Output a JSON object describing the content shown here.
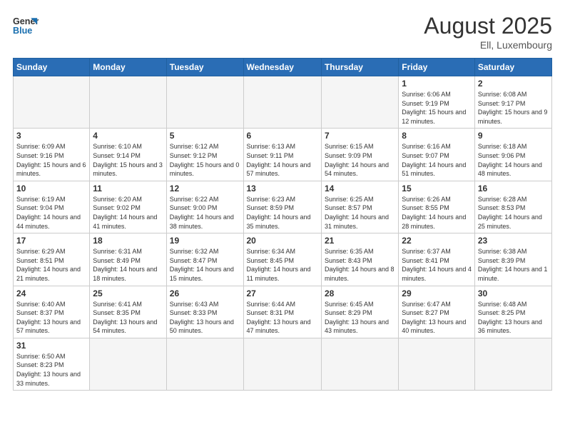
{
  "header": {
    "logo_general": "General",
    "logo_blue": "Blue",
    "title": "August 2025",
    "subtitle": "Ell, Luxembourg"
  },
  "days_of_week": [
    "Sunday",
    "Monday",
    "Tuesday",
    "Wednesday",
    "Thursday",
    "Friday",
    "Saturday"
  ],
  "weeks": [
    [
      {
        "day": "",
        "info": ""
      },
      {
        "day": "",
        "info": ""
      },
      {
        "day": "",
        "info": ""
      },
      {
        "day": "",
        "info": ""
      },
      {
        "day": "",
        "info": ""
      },
      {
        "day": "1",
        "info": "Sunrise: 6:06 AM\nSunset: 9:19 PM\nDaylight: 15 hours and 12 minutes."
      },
      {
        "day": "2",
        "info": "Sunrise: 6:08 AM\nSunset: 9:17 PM\nDaylight: 15 hours and 9 minutes."
      }
    ],
    [
      {
        "day": "3",
        "info": "Sunrise: 6:09 AM\nSunset: 9:16 PM\nDaylight: 15 hours and 6 minutes."
      },
      {
        "day": "4",
        "info": "Sunrise: 6:10 AM\nSunset: 9:14 PM\nDaylight: 15 hours and 3 minutes."
      },
      {
        "day": "5",
        "info": "Sunrise: 6:12 AM\nSunset: 9:12 PM\nDaylight: 15 hours and 0 minutes."
      },
      {
        "day": "6",
        "info": "Sunrise: 6:13 AM\nSunset: 9:11 PM\nDaylight: 14 hours and 57 minutes."
      },
      {
        "day": "7",
        "info": "Sunrise: 6:15 AM\nSunset: 9:09 PM\nDaylight: 14 hours and 54 minutes."
      },
      {
        "day": "8",
        "info": "Sunrise: 6:16 AM\nSunset: 9:07 PM\nDaylight: 14 hours and 51 minutes."
      },
      {
        "day": "9",
        "info": "Sunrise: 6:18 AM\nSunset: 9:06 PM\nDaylight: 14 hours and 48 minutes."
      }
    ],
    [
      {
        "day": "10",
        "info": "Sunrise: 6:19 AM\nSunset: 9:04 PM\nDaylight: 14 hours and 44 minutes."
      },
      {
        "day": "11",
        "info": "Sunrise: 6:20 AM\nSunset: 9:02 PM\nDaylight: 14 hours and 41 minutes."
      },
      {
        "day": "12",
        "info": "Sunrise: 6:22 AM\nSunset: 9:00 PM\nDaylight: 14 hours and 38 minutes."
      },
      {
        "day": "13",
        "info": "Sunrise: 6:23 AM\nSunset: 8:59 PM\nDaylight: 14 hours and 35 minutes."
      },
      {
        "day": "14",
        "info": "Sunrise: 6:25 AM\nSunset: 8:57 PM\nDaylight: 14 hours and 31 minutes."
      },
      {
        "day": "15",
        "info": "Sunrise: 6:26 AM\nSunset: 8:55 PM\nDaylight: 14 hours and 28 minutes."
      },
      {
        "day": "16",
        "info": "Sunrise: 6:28 AM\nSunset: 8:53 PM\nDaylight: 14 hours and 25 minutes."
      }
    ],
    [
      {
        "day": "17",
        "info": "Sunrise: 6:29 AM\nSunset: 8:51 PM\nDaylight: 14 hours and 21 minutes."
      },
      {
        "day": "18",
        "info": "Sunrise: 6:31 AM\nSunset: 8:49 PM\nDaylight: 14 hours and 18 minutes."
      },
      {
        "day": "19",
        "info": "Sunrise: 6:32 AM\nSunset: 8:47 PM\nDaylight: 14 hours and 15 minutes."
      },
      {
        "day": "20",
        "info": "Sunrise: 6:34 AM\nSunset: 8:45 PM\nDaylight: 14 hours and 11 minutes."
      },
      {
        "day": "21",
        "info": "Sunrise: 6:35 AM\nSunset: 8:43 PM\nDaylight: 14 hours and 8 minutes."
      },
      {
        "day": "22",
        "info": "Sunrise: 6:37 AM\nSunset: 8:41 PM\nDaylight: 14 hours and 4 minutes."
      },
      {
        "day": "23",
        "info": "Sunrise: 6:38 AM\nSunset: 8:39 PM\nDaylight: 14 hours and 1 minute."
      }
    ],
    [
      {
        "day": "24",
        "info": "Sunrise: 6:40 AM\nSunset: 8:37 PM\nDaylight: 13 hours and 57 minutes."
      },
      {
        "day": "25",
        "info": "Sunrise: 6:41 AM\nSunset: 8:35 PM\nDaylight: 13 hours and 54 minutes."
      },
      {
        "day": "26",
        "info": "Sunrise: 6:43 AM\nSunset: 8:33 PM\nDaylight: 13 hours and 50 minutes."
      },
      {
        "day": "27",
        "info": "Sunrise: 6:44 AM\nSunset: 8:31 PM\nDaylight: 13 hours and 47 minutes."
      },
      {
        "day": "28",
        "info": "Sunrise: 6:45 AM\nSunset: 8:29 PM\nDaylight: 13 hours and 43 minutes."
      },
      {
        "day": "29",
        "info": "Sunrise: 6:47 AM\nSunset: 8:27 PM\nDaylight: 13 hours and 40 minutes."
      },
      {
        "day": "30",
        "info": "Sunrise: 6:48 AM\nSunset: 8:25 PM\nDaylight: 13 hours and 36 minutes."
      }
    ],
    [
      {
        "day": "31",
        "info": "Sunrise: 6:50 AM\nSunset: 8:23 PM\nDaylight: 13 hours and 33 minutes."
      },
      {
        "day": "",
        "info": ""
      },
      {
        "day": "",
        "info": ""
      },
      {
        "day": "",
        "info": ""
      },
      {
        "day": "",
        "info": ""
      },
      {
        "day": "",
        "info": ""
      },
      {
        "day": "",
        "info": ""
      }
    ]
  ]
}
